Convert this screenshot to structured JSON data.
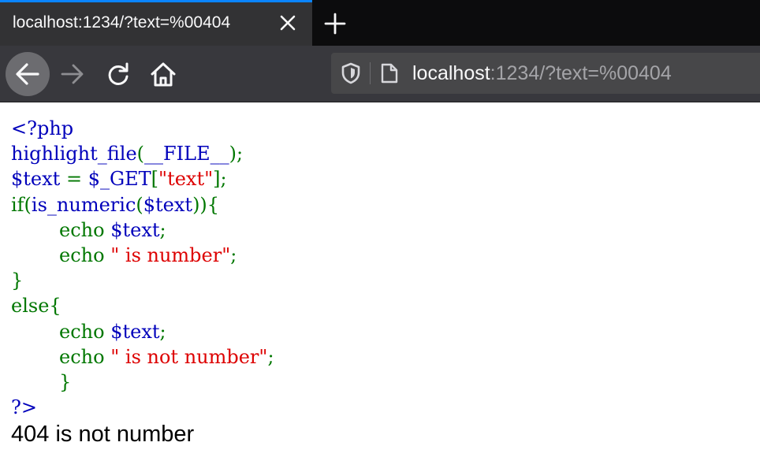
{
  "tab": {
    "title": "localhost:1234/?text=%00404",
    "close_icon": "close-icon",
    "new_tab_icon": "plus-icon"
  },
  "toolbar": {
    "back_icon": "arrow-left-icon",
    "forward_icon": "arrow-right-icon",
    "reload_icon": "reload-icon",
    "home_icon": "home-icon",
    "url_host": "localhost",
    "url_rest": ":1234/?text=%00404",
    "shield_icon": "tracking-protection-shield-icon",
    "page_icon": "page-icon"
  },
  "colors": {
    "php_default": "#0000bb",
    "php_keyword": "#007700",
    "php_string": "#dd0000",
    "tab_accent": "#0a84ff"
  },
  "code_lines": [
    [
      [
        "def",
        "<?php"
      ]
    ],
    [
      [
        "def",
        "highlight_file"
      ],
      [
        "kw",
        "("
      ],
      [
        "def",
        "__FILE__"
      ],
      [
        "kw",
        ");"
      ]
    ],
    [
      [
        "def",
        "$text "
      ],
      [
        "kw",
        "= "
      ],
      [
        "def",
        "$_GET"
      ],
      [
        "kw",
        "["
      ],
      [
        "str",
        "\"text\""
      ],
      [
        "kw",
        "];"
      ]
    ],
    [
      [
        "kw",
        "if("
      ],
      [
        "def",
        "is_numeric"
      ],
      [
        "kw",
        "("
      ],
      [
        "def",
        "$text"
      ],
      [
        "kw",
        ")){"
      ]
    ],
    [
      [
        "kw",
        "        echo "
      ],
      [
        "def",
        "$text"
      ],
      [
        "kw",
        ";"
      ]
    ],
    [
      [
        "kw",
        "        echo "
      ],
      [
        "str",
        "\" is number\""
      ],
      [
        "kw",
        ";"
      ]
    ],
    [
      [
        "kw",
        "}"
      ]
    ],
    [
      [
        "kw",
        "else{"
      ]
    ],
    [
      [
        "kw",
        "        echo "
      ],
      [
        "def",
        "$text"
      ],
      [
        "kw",
        ";"
      ]
    ],
    [
      [
        "kw",
        "        echo "
      ],
      [
        "str",
        "\" is not number\""
      ],
      [
        "kw",
        ";"
      ]
    ],
    [
      [
        "kw",
        "        }"
      ]
    ],
    [
      [
        "def",
        "?>"
      ]
    ]
  ],
  "output_text": "404 is not number"
}
